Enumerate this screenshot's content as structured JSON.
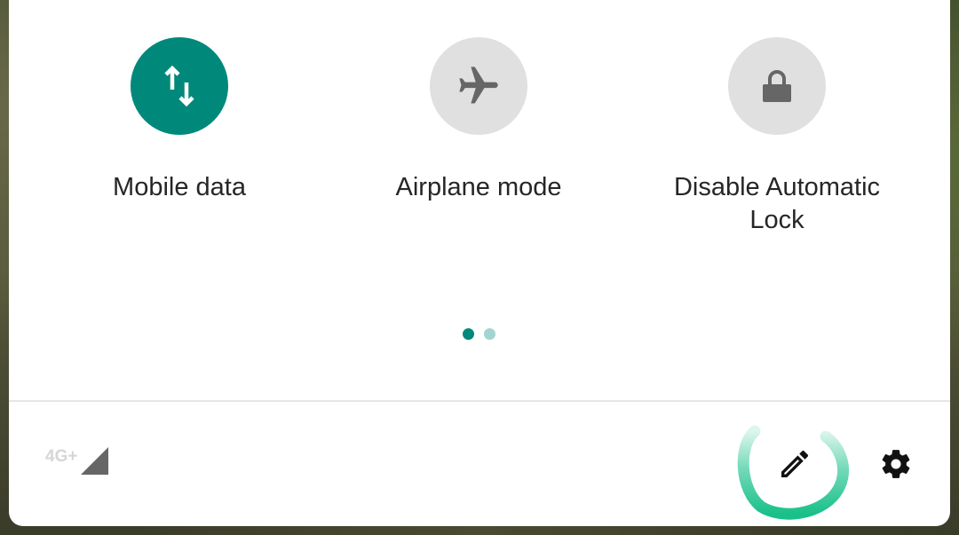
{
  "tiles": [
    {
      "label": "Mobile data",
      "icon": "mobile-data-icon",
      "state": "on"
    },
    {
      "label": "Airplane mode",
      "icon": "airplane-icon",
      "state": "off"
    },
    {
      "label": "Disable Automatic\nLock",
      "icon": "lock-icon",
      "state": "off"
    }
  ],
  "page_indicator": {
    "pages": 2,
    "current": 1
  },
  "footer": {
    "network_type": "4G+",
    "signal_icon": "signal-icon",
    "edit_icon": "pencil-icon",
    "settings_icon": "gear-icon"
  },
  "colors": {
    "accent": "#00897b",
    "tile_off": "#e0e0e0",
    "icon_off": "#666666",
    "dot_inactive": "#a3d4cf",
    "highlight_ring": "#19c08a"
  }
}
